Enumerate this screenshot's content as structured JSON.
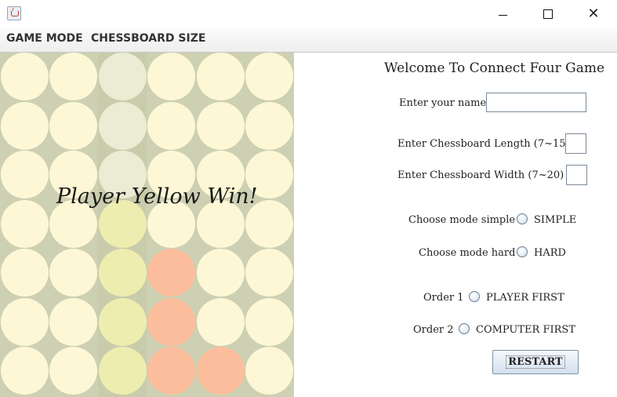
{
  "window": {
    "minimize_glyph": "",
    "close_glyph": "✕"
  },
  "menubar": {
    "items": [
      "GAME MODE",
      "CHESSBOARD SIZE"
    ]
  },
  "board": {
    "columns": 6,
    "rows": 7,
    "highlighted_column": 2,
    "colors": {
      "board_bg": "#cdd0b2",
      "empty": "#fdf7d6",
      "empty_faded": "#ecebd3",
      "yellow": "#eeedb0",
      "red": "#fcbe9d"
    },
    "cells": [
      [
        "empty",
        "empty",
        "empty_faded",
        "empty",
        "empty",
        "empty"
      ],
      [
        "empty",
        "empty",
        "empty_faded",
        "empty",
        "empty",
        "empty"
      ],
      [
        "empty",
        "empty",
        "empty_faded",
        "empty",
        "empty",
        "empty"
      ],
      [
        "empty",
        "empty",
        "yellow",
        "empty",
        "empty",
        "empty"
      ],
      [
        "empty",
        "empty",
        "yellow",
        "red",
        "empty",
        "empty"
      ],
      [
        "empty",
        "empty",
        "yellow",
        "red",
        "empty",
        "empty"
      ],
      [
        "empty",
        "empty",
        "yellow",
        "red",
        "red",
        "empty"
      ]
    ],
    "status_message": "Player Yellow Win!"
  },
  "panel": {
    "welcome": "Welcome To Connect Four Game",
    "name_label": "Enter your name",
    "name_value": "",
    "length_label": "Enter Chessboard Length (7~15)",
    "length_value": "",
    "width_label": "Enter Chessboard Width  (7~20)",
    "width_value": "",
    "mode_simple_label": "Choose mode simple",
    "mode_simple_option": "SIMPLE",
    "mode_hard_label": "Choose mode hard",
    "mode_hard_option": "HARD",
    "order1_label": "Order 1",
    "order1_option": "PLAYER FIRST",
    "order2_label": "Order 2",
    "order2_option": "COMPUTER FIRST",
    "restart_label": "RESTART"
  }
}
